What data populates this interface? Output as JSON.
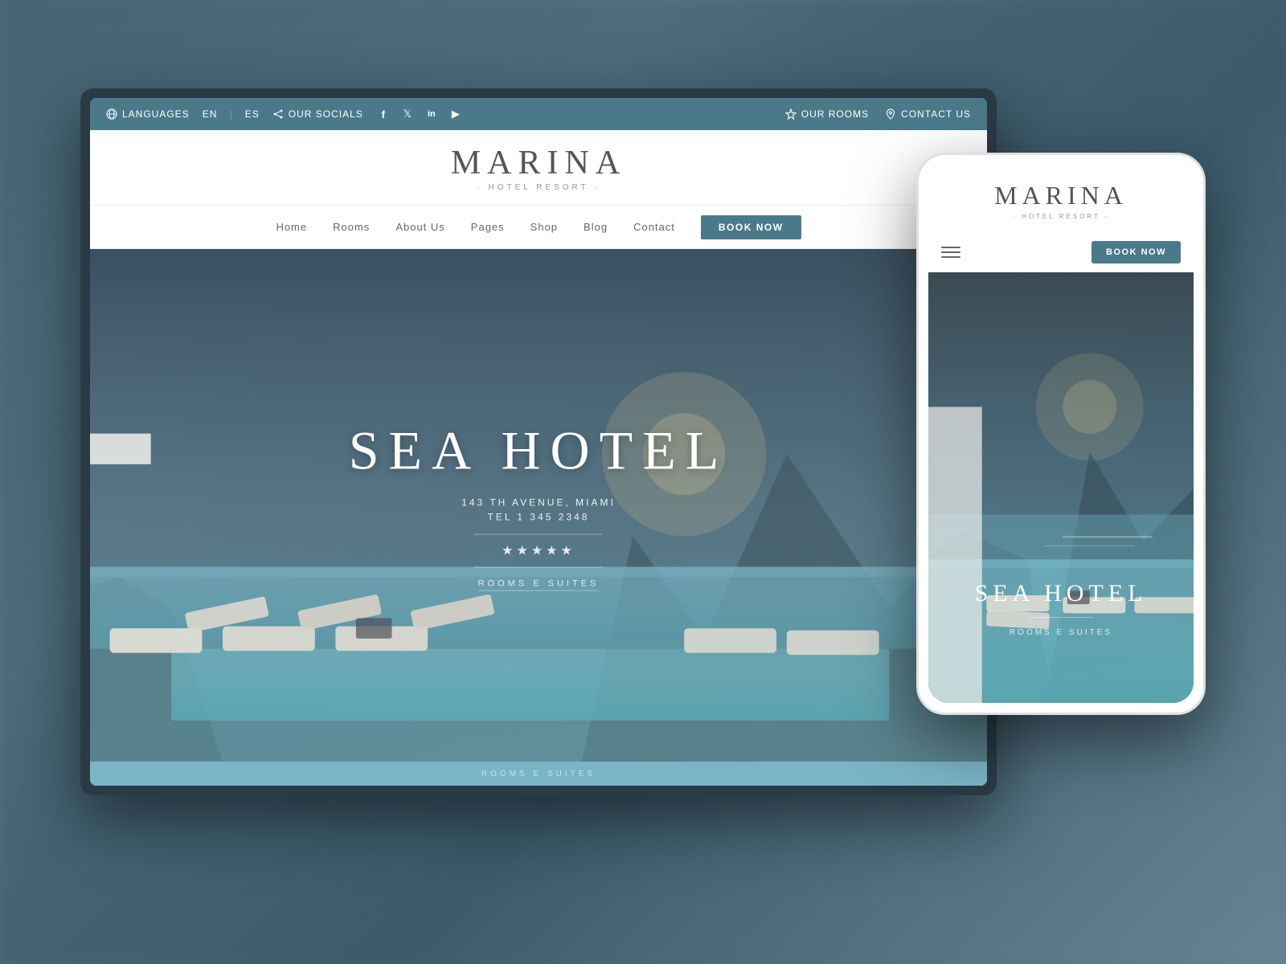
{
  "background": {
    "color": "#4a6a7a"
  },
  "topbar": {
    "languages_label": "LANGUAGES",
    "lang_en": "EN",
    "lang_es": "ES",
    "socials_label": "OUR SOCIALS",
    "social_icons": [
      "f",
      "t",
      "in",
      "▶"
    ],
    "rooms_label": "OUR ROOMS",
    "contact_label": "CONTACT US"
  },
  "desktop": {
    "logo_main": "MARINA",
    "logo_sub": "· HOTEL RESORT ·",
    "nav_items": [
      "Home",
      "Rooms",
      "About Us",
      "Pages",
      "Shop",
      "Blog",
      "Contact"
    ],
    "book_now": "BOOK NOW",
    "hero_title": "SEA HOTEL",
    "hero_address": "143 TH AVENUE, MIAMI",
    "hero_tel": "TEL 1 345 2348",
    "hero_stars": "★★★★★",
    "hero_rooms": "ROOMS E SUITES",
    "bottom_bar_text": "ROOMS E SUITES"
  },
  "mobile": {
    "logo_main": "MARINA",
    "logo_sub": "· HOTEL RESORT ·",
    "book_now": "BOOK NOW",
    "hero_title": "SEA HOTEL",
    "hero_rooms": "ROOMS E SUITES"
  }
}
